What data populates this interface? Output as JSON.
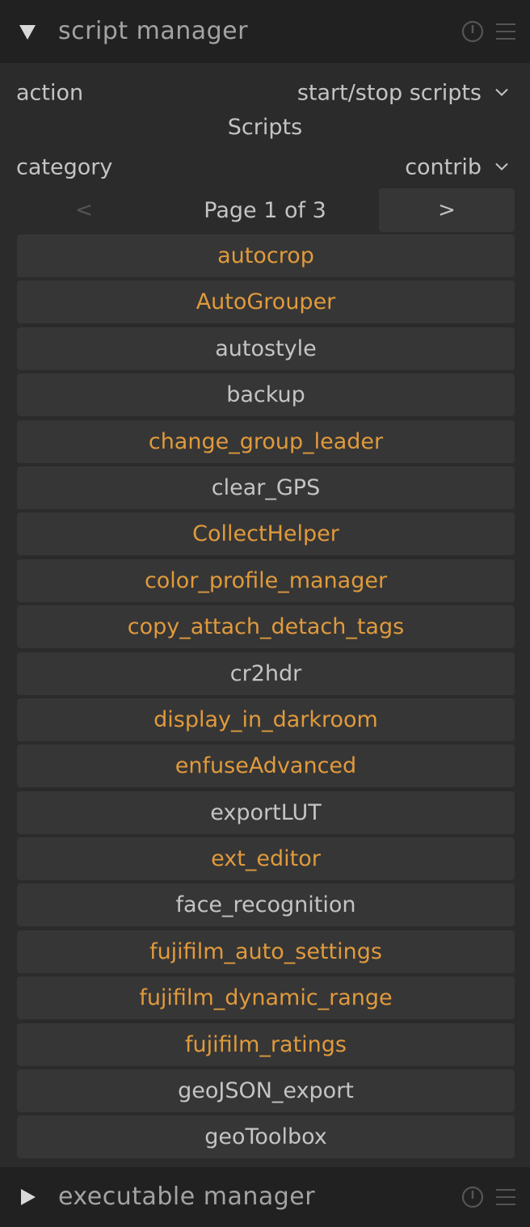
{
  "script_manager": {
    "title": "script manager",
    "expanded": true,
    "action_label": "action",
    "action_value": "start/stop scripts",
    "scripts_heading": "Scripts",
    "category_label": "category",
    "category_value": "contrib",
    "pager": {
      "prev_label": "<",
      "page_label": "Page 1 of 3",
      "next_label": ">"
    },
    "scripts": [
      {
        "label": "autocrop",
        "active": true
      },
      {
        "label": "AutoGrouper",
        "active": true
      },
      {
        "label": "autostyle",
        "active": false
      },
      {
        "label": "backup",
        "active": false
      },
      {
        "label": "change_group_leader",
        "active": true
      },
      {
        "label": "clear_GPS",
        "active": false
      },
      {
        "label": "CollectHelper",
        "active": true
      },
      {
        "label": "color_profile_manager",
        "active": true
      },
      {
        "label": "copy_attach_detach_tags",
        "active": true
      },
      {
        "label": "cr2hdr",
        "active": false
      },
      {
        "label": "display_in_darkroom",
        "active": true
      },
      {
        "label": "enfuseAdvanced",
        "active": true
      },
      {
        "label": "exportLUT",
        "active": false
      },
      {
        "label": "ext_editor",
        "active": true
      },
      {
        "label": "face_recognition",
        "active": false
      },
      {
        "label": "fujifilm_auto_settings",
        "active": true
      },
      {
        "label": "fujifilm_dynamic_range",
        "active": true
      },
      {
        "label": "fujifilm_ratings",
        "active": true
      },
      {
        "label": "geoJSON_export",
        "active": false
      },
      {
        "label": "geoToolbox",
        "active": false
      }
    ]
  },
  "executable_manager": {
    "title": "executable manager",
    "expanded": false
  },
  "colors": {
    "active_script": "#e09a3c",
    "inactive_script": "#c4c4c4",
    "header_bg": "#212121",
    "panel_bg": "#2b2b2b",
    "button_bg": "#363636"
  },
  "icons": {
    "expanded": "triangle-down-icon",
    "collapsed": "triangle-right-icon",
    "reset": "reset-icon",
    "presets": "presets-menu-icon",
    "dropdown": "chevron-down-icon"
  }
}
